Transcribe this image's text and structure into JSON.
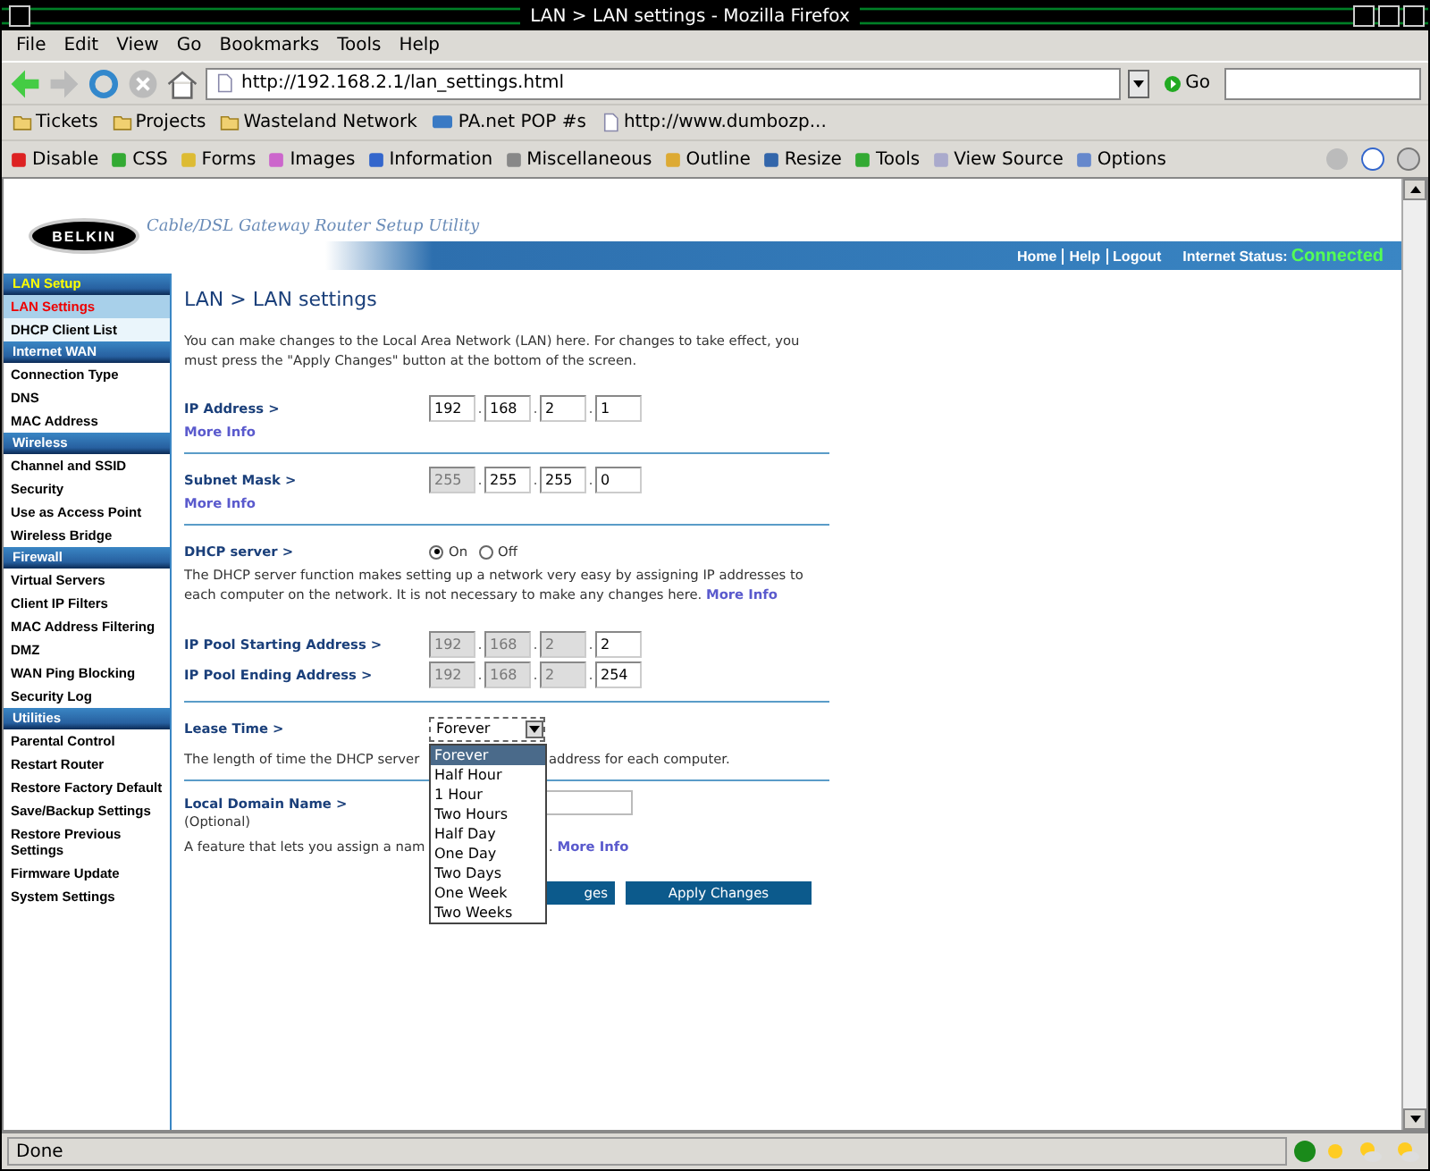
{
  "window": {
    "title": "LAN > LAN settings - Mozilla Firefox"
  },
  "menu": [
    "File",
    "Edit",
    "View",
    "Go",
    "Bookmarks",
    "Tools",
    "Help"
  ],
  "nav": {
    "url": "http://192.168.2.1/lan_settings.html",
    "go": "Go"
  },
  "bookmarks": [
    {
      "label": "Tickets",
      "kind": "folder"
    },
    {
      "label": "Projects",
      "kind": "folder"
    },
    {
      "label": "Wasteland Network",
      "kind": "folder"
    },
    {
      "label": "PA.net POP #s",
      "kind": "site"
    },
    {
      "label": "http://www.dumbozp...",
      "kind": "page"
    }
  ],
  "devtools": [
    "Disable",
    "CSS",
    "Forms",
    "Images",
    "Information",
    "Miscellaneous",
    "Outline",
    "Resize",
    "Tools",
    "View Source",
    "Options"
  ],
  "router": {
    "brand": "BELKIN",
    "tagline": "Cable/DSL Gateway Router Setup Utility",
    "links": [
      "Home",
      "Help",
      "Logout"
    ],
    "status_label": "Internet Status:",
    "status_value": "Connected"
  },
  "sidebar": [
    {
      "title": "LAN Setup",
      "items": [
        {
          "label": "LAN Settings",
          "selected": true
        },
        {
          "label": "DHCP Client List",
          "selected": false
        }
      ]
    },
    {
      "title": "Internet WAN",
      "items": [
        {
          "label": "Connection Type",
          "selected": false
        },
        {
          "label": "DNS",
          "selected": false
        },
        {
          "label": "MAC Address",
          "selected": false
        }
      ]
    },
    {
      "title": "Wireless",
      "items": [
        {
          "label": "Channel and SSID",
          "selected": false
        },
        {
          "label": "Security",
          "selected": false
        },
        {
          "label": "Use as Access Point",
          "selected": false
        },
        {
          "label": "Wireless Bridge",
          "selected": false
        }
      ]
    },
    {
      "title": "Firewall",
      "items": [
        {
          "label": "Virtual Servers",
          "selected": false
        },
        {
          "label": "Client IP Filters",
          "selected": false
        },
        {
          "label": "MAC Address Filtering",
          "selected": false
        },
        {
          "label": "DMZ",
          "selected": false
        },
        {
          "label": "WAN Ping Blocking",
          "selected": false
        },
        {
          "label": "Security Log",
          "selected": false
        }
      ]
    },
    {
      "title": "Utilities",
      "items": [
        {
          "label": "Parental Control",
          "selected": false
        },
        {
          "label": "Restart Router",
          "selected": false
        },
        {
          "label": "Restore Factory Default",
          "selected": false
        },
        {
          "label": "Save/Backup Settings",
          "selected": false
        },
        {
          "label": "Restore Previous Settings",
          "selected": false
        },
        {
          "label": "Firmware Update",
          "selected": false
        },
        {
          "label": "System Settings",
          "selected": false
        }
      ]
    }
  ],
  "page": {
    "title": "LAN > LAN settings",
    "intro": "You can make changes to the Local Area Network (LAN) here. For changes to take effect, you must press the \"Apply Changes\" button at the bottom of the screen.",
    "ip_address": {
      "label": "IP Address >",
      "more_info": "More Info",
      "octets": [
        {
          "value": "192",
          "disabled": false
        },
        {
          "separator": ".",
          "value": "168",
          "disabled": false
        },
        {
          "separator": ".",
          "value": "2",
          "disabled": false
        },
        {
          "separator": ".",
          "value": "1",
          "disabled": false
        }
      ]
    },
    "subnet_mask": {
      "label": "Subnet Mask >",
      "more_info": "More Info",
      "octets": [
        {
          "value": "255",
          "disabled": true
        },
        {
          "separator": ".",
          "value": "255",
          "disabled": false
        },
        {
          "separator": ".",
          "value": "255",
          "disabled": false
        },
        {
          "separator": ".",
          "value": "0",
          "disabled": false
        }
      ]
    },
    "dhcp": {
      "label": "DHCP server >",
      "options": [
        {
          "label": "On",
          "selected": true
        },
        {
          "label": "Off",
          "selected": false
        }
      ],
      "description": "The DHCP server function makes setting up a network very easy by assigning IP addresses to each computer on the network. It is not necessary to make any changes here.",
      "more_info": "More Info"
    },
    "pool_start": {
      "label": "IP Pool Starting Address >",
      "octets": [
        {
          "value": "192",
          "disabled": true
        },
        {
          "separator": ".",
          "value": "168",
          "disabled": true
        },
        {
          "separator": ".",
          "value": "2",
          "disabled": true
        },
        {
          "separator": ".",
          "value": "2",
          "disabled": false
        }
      ]
    },
    "pool_end": {
      "label": "IP Pool Ending Address >",
      "octets": [
        {
          "value": "192",
          "disabled": true
        },
        {
          "separator": ".",
          "value": "168",
          "disabled": true
        },
        {
          "separator": ".",
          "value": "2",
          "disabled": true
        },
        {
          "separator": ".",
          "value": "254",
          "disabled": false
        }
      ]
    },
    "lease": {
      "label": "Lease Time >",
      "value": "Forever",
      "expanded": true,
      "options": [
        {
          "label": "Forever",
          "selected": true
        },
        {
          "label": "Half Hour",
          "selected": false
        },
        {
          "label": "1 Hour",
          "selected": false
        },
        {
          "label": "Two Hours",
          "selected": false
        },
        {
          "label": "Half Day",
          "selected": false
        },
        {
          "label": "One Day",
          "selected": false
        },
        {
          "label": "Two Days",
          "selected": false
        },
        {
          "label": "One Week",
          "selected": false
        },
        {
          "label": "Two Weeks",
          "selected": false
        }
      ],
      "description_left": "The length of time the DHCP server",
      "description_right": "address for each computer."
    },
    "domain": {
      "label": "Local Domain Name >",
      "optional": "(Optional)",
      "description_left": "A feature that lets you assign a nam",
      "description_right": ".",
      "more_info": "More Info"
    },
    "buttons": [
      "ges",
      "Apply Changes"
    ]
  },
  "status_bar": {
    "text": "Done"
  }
}
